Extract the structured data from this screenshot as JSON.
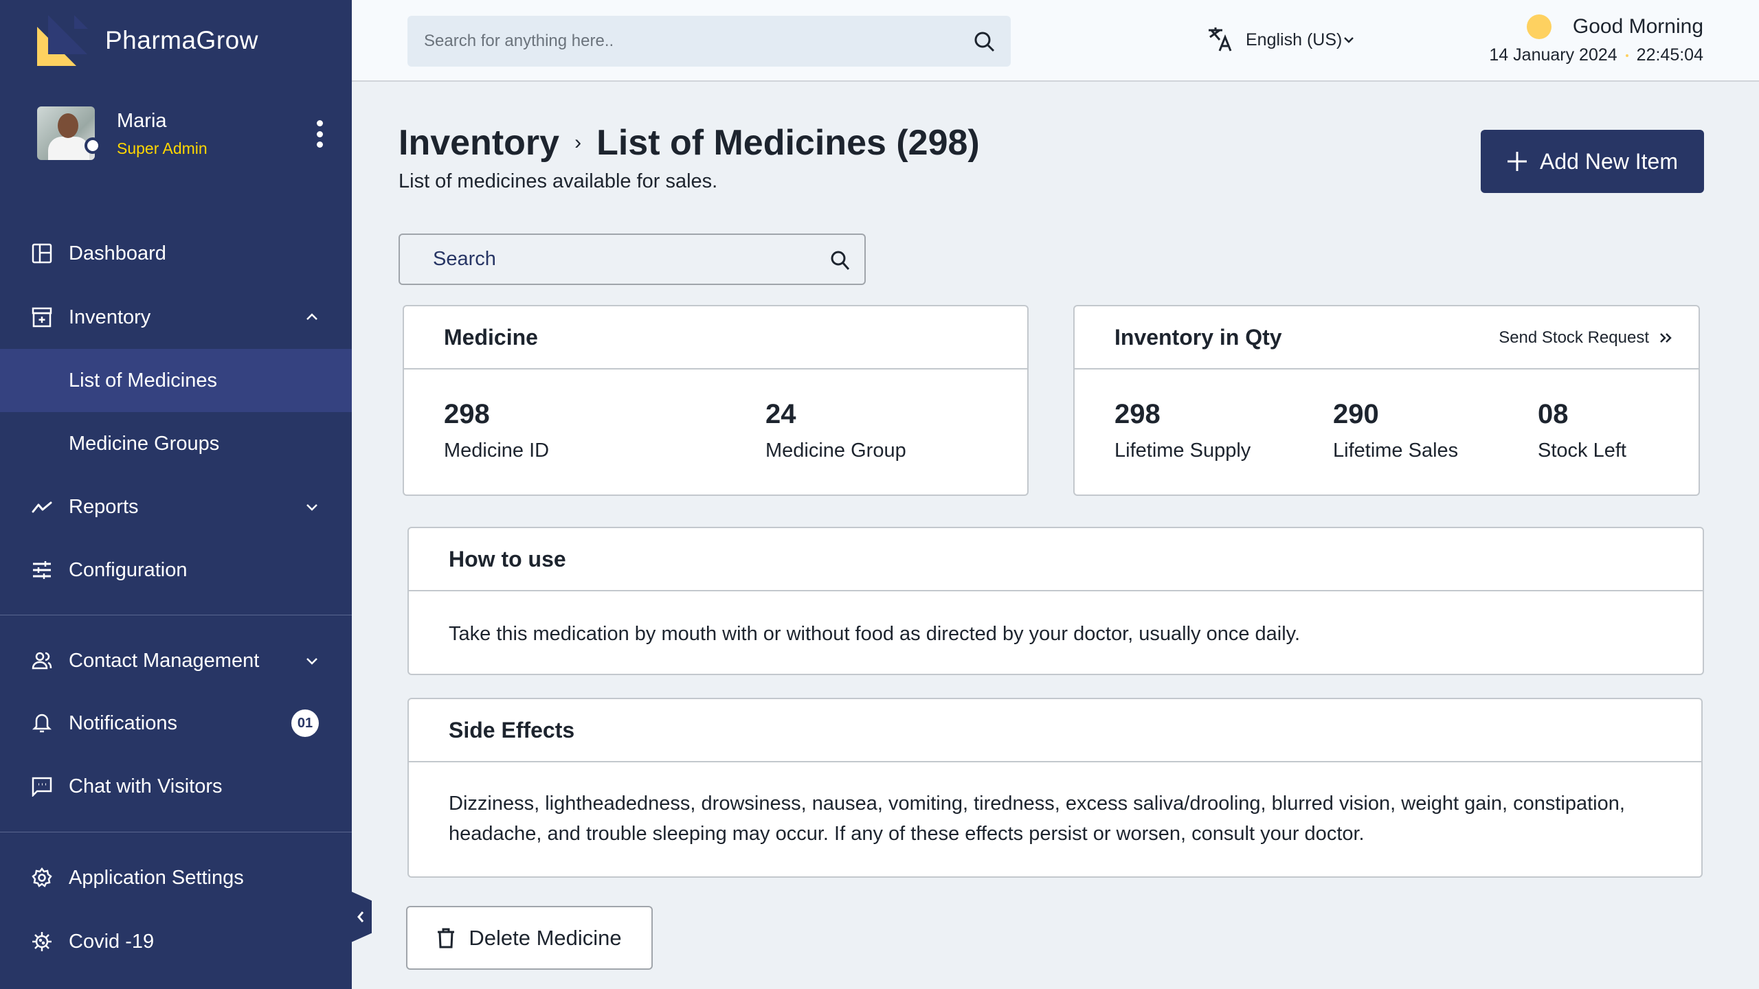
{
  "app": {
    "name": "PharmaGrow",
    "brand_colors": {
      "sidebar": "#283665",
      "accent": "#fed600"
    }
  },
  "user": {
    "name": "Maria",
    "role": "Super Admin"
  },
  "sidebar": {
    "items": [
      {
        "label": "Dashboard",
        "icon": "dashboard-icon"
      },
      {
        "label": "Inventory",
        "icon": "inventory-icon",
        "expanded": true
      },
      {
        "label": "List of Medicines",
        "active": true
      },
      {
        "label": "Medicine Groups"
      },
      {
        "label": "Reports",
        "icon": "reports-icon"
      },
      {
        "label": "Configuration",
        "icon": "sliders-icon"
      },
      {
        "label": "Contact Management",
        "icon": "users-icon"
      },
      {
        "label": "Notifications",
        "icon": "bell-icon",
        "badge": "01"
      },
      {
        "label": "Chat with Visitors",
        "icon": "chat-icon"
      },
      {
        "label": "Application Settings",
        "icon": "gear-icon"
      },
      {
        "label": "Covid -19",
        "icon": "virus-icon"
      }
    ]
  },
  "topbar": {
    "search_placeholder": "Search for anything here..",
    "language": "English (US)",
    "greeting": "Good Morning",
    "date": "14 January 2024",
    "time": "22:45:04"
  },
  "page": {
    "breadcrumb_parent": "Inventory",
    "title": "List of Medicines (298)",
    "subtitle": "List of medicines available for sales.",
    "add_button": "Add New Item",
    "search_placeholder": "Search",
    "delete_button": "Delete Medicine"
  },
  "medicine_card": {
    "title": "Medicine",
    "stats": [
      {
        "value": "298",
        "label": "Medicine ID"
      },
      {
        "value": "24",
        "label": "Medicine Group"
      }
    ]
  },
  "inventory_card": {
    "title": "Inventory in Qty",
    "link": "Send Stock Request",
    "stats": [
      {
        "value": "298",
        "label": "Lifetime Supply"
      },
      {
        "value": "290",
        "label": "Lifetime Sales"
      },
      {
        "value": "08",
        "label": "Stock Left"
      }
    ]
  },
  "how_to_use": {
    "title": "How to use",
    "text": "Take this medication by mouth with or without food as directed by your doctor, usually once daily."
  },
  "side_effects": {
    "title": "Side Effects",
    "text": "Dizziness, lightheadedness, drowsiness, nausea, vomiting, tiredness, excess saliva/drooling, blurred vision, weight gain, constipation, headache, and trouble sleeping may occur. If any of these effects persist or worsen, consult your doctor."
  }
}
